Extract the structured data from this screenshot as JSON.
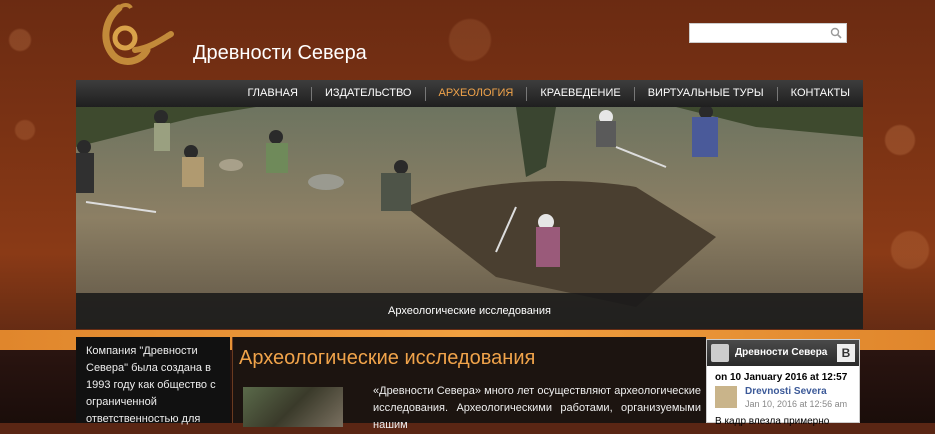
{
  "site": {
    "title": "Древности Севера"
  },
  "search": {
    "placeholder": "",
    "icon": "search-icon"
  },
  "nav": {
    "items": [
      {
        "label": "ГЛАВНАЯ",
        "active": false
      },
      {
        "label": "ИЗДАТЕЛЬСТВО",
        "active": false
      },
      {
        "label": "АРХЕОЛОГИЯ",
        "active": true
      },
      {
        "label": "КРАЕВЕДЕНИЕ",
        "active": false
      },
      {
        "label": "ВИРТУАЛЬНЫЕ ТУРЫ",
        "active": false
      },
      {
        "label": "КОНТАКТЫ",
        "active": false
      }
    ],
    "active_color": "#f0a34a"
  },
  "hero": {
    "caption": "Археологические исследования"
  },
  "left_col": {
    "text": "Компания \"Древности Севера\" была создана в 1993 году как общество с ограниченной ответственностью для"
  },
  "main": {
    "title": "Археологические исследования",
    "text": "«Древности Севера» много лет осуществляют археологические исследования. Археологическими работами, организуемыми нашим"
  },
  "facebook": {
    "page_name": "Древности Севера",
    "badge": "B",
    "post_date": "on 10 January 2016 at 12:57",
    "author": "Drevnosti Severa",
    "author_time": "Jan 10, 2016 at 12:56 am",
    "snippet": "В кадр влезла примерно"
  },
  "colors": {
    "accent": "#f0a34a",
    "background": "#5a2614",
    "nav": "#2a2a2a"
  }
}
